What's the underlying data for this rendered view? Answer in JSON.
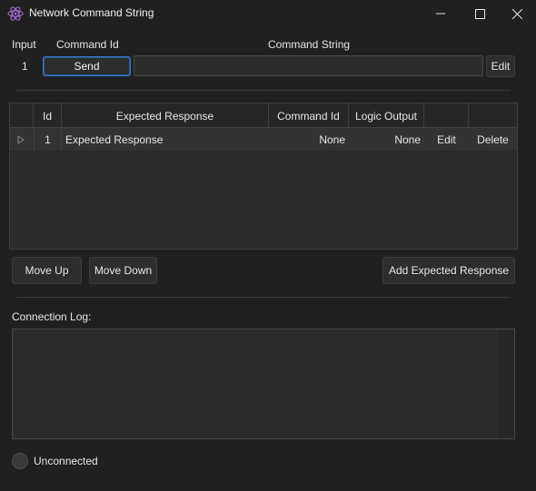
{
  "window": {
    "title": "Network Command String",
    "icon": "react-atom-icon",
    "accent_color": "#a66cd6"
  },
  "header": {
    "input_label": "Input",
    "command_id_label": "Command Id",
    "command_string_label": "Command String"
  },
  "command": {
    "input_number": "1",
    "send_label": "Send",
    "command_string_value": "",
    "edit_label": "Edit"
  },
  "grid": {
    "columns": [
      "Id",
      "Expected Response",
      "Command Id",
      "Logic Output"
    ],
    "rows": [
      {
        "id": "1",
        "expected_response": "Expected Response",
        "command_id": "None",
        "logic_output": "None",
        "edit_label": "Edit",
        "delete_label": "Delete"
      }
    ]
  },
  "actions": {
    "move_up": "Move Up",
    "move_down": "Move Down",
    "add_expected_response": "Add Expected Response"
  },
  "log": {
    "label": "Connection Log:",
    "content": ""
  },
  "status": {
    "text": "Unconnected",
    "color": "#3a3a3a"
  }
}
